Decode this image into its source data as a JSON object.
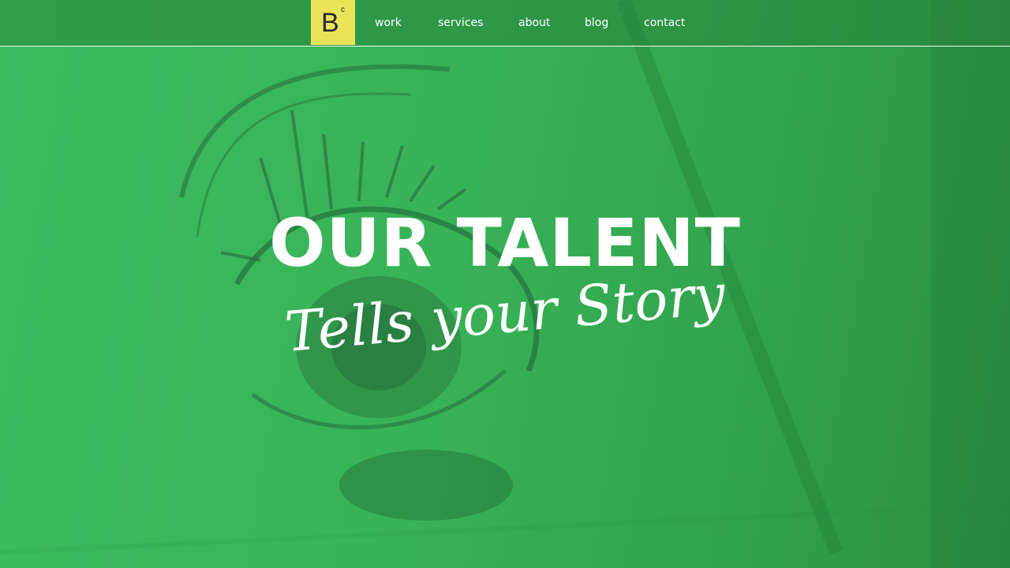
{
  "brand": {
    "logo_letter": "B",
    "logo_superscript": "c",
    "logo_color": "#e9e35a"
  },
  "nav": {
    "items": [
      {
        "label": "work"
      },
      {
        "label": "services"
      },
      {
        "label": "about"
      },
      {
        "label": "blog"
      },
      {
        "label": "contact"
      }
    ]
  },
  "hero": {
    "headline": "OUR TALENT",
    "subline": "Tells your Story",
    "overlay_color": "#38b257"
  }
}
